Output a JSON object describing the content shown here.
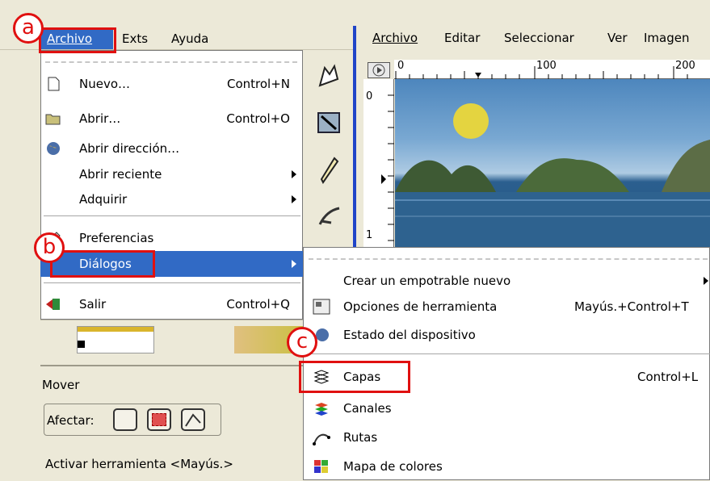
{
  "toolbox": {
    "menubar": {
      "archivo": "Archivo",
      "exts": "Exts",
      "ayuda": "Ayuda"
    },
    "options": {
      "title": "Mover",
      "afectar_label": "Afectar:",
      "activar_label": "Activar herramienta  <Mayús.>"
    }
  },
  "image_window": {
    "menubar": [
      "Archivo",
      "Editar",
      "Seleccionar",
      "Ver",
      "Imagen"
    ],
    "ruler_top": [
      "0",
      "100",
      "200"
    ],
    "ruler_left": [
      "0",
      "1"
    ]
  },
  "archivo_menu": {
    "items": [
      {
        "label": "Nuevo…",
        "accel": "Control+N",
        "icon": "new-document-icon"
      },
      {
        "label": "Abrir…",
        "accel": "Control+O",
        "icon": "open-folder-icon"
      },
      {
        "label": "Abrir dirección…",
        "accel": "",
        "icon": "globe-icon"
      },
      {
        "label": "Abrir reciente",
        "accel": "",
        "submenu": true
      },
      {
        "label": "Adquirir",
        "accel": "",
        "submenu": true
      },
      {
        "label": "Preferencias",
        "accel": "",
        "icon": "preferences-icon"
      },
      {
        "label": "Diálogos",
        "accel": "",
        "submenu": true,
        "highlighted": true
      },
      {
        "label": "Salir",
        "accel": "Control+Q",
        "icon": "quit-icon"
      }
    ]
  },
  "dialogos_menu": {
    "items": [
      {
        "label": "Crear un empotrable nuevo",
        "accel": "",
        "submenu": true
      },
      {
        "label": "Opciones de herramienta",
        "accel": "Mayús.+Control+T",
        "icon": "tool-options-icon"
      },
      {
        "label": "Estado del dispositivo",
        "accel": "",
        "icon": "device-status-icon"
      },
      {
        "label": "Capas",
        "accel": "Control+L",
        "icon": "layers-icon"
      },
      {
        "label": "Canales",
        "accel": "",
        "icon": "channels-icon"
      },
      {
        "label": "Rutas",
        "accel": "",
        "icon": "paths-icon"
      },
      {
        "label": "Mapa de colores",
        "accel": "",
        "icon": "colormap-icon"
      }
    ]
  },
  "annotations": {
    "a": "a",
    "b": "b",
    "c": "c"
  },
  "colors": {
    "highlight": "#316ac5",
    "annotation_red": "#e01010",
    "sun": "#e4d440"
  }
}
